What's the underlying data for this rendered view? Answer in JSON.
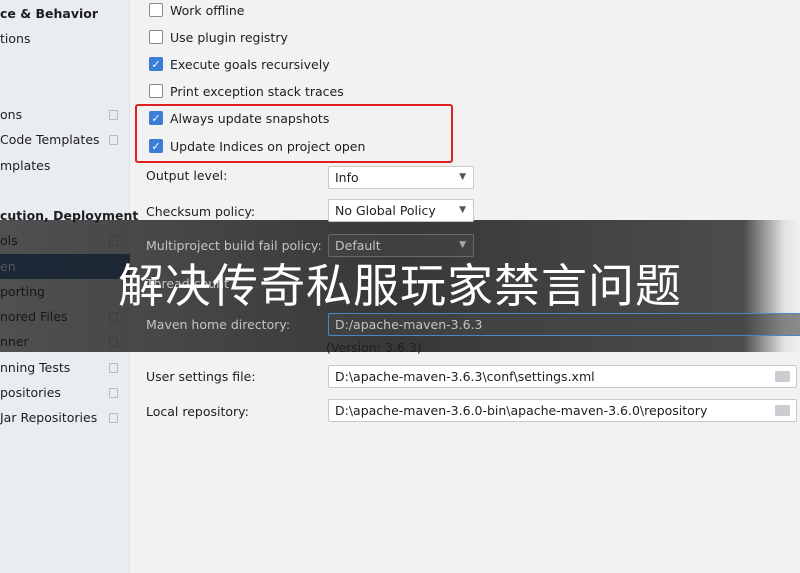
{
  "sidebar": {
    "items": [
      {
        "label": "ce & Behavior",
        "bold": true
      },
      {
        "label": "tions"
      },
      {
        "label": "ons",
        "copy": true
      },
      {
        "label": " Code Templates",
        "copy": true
      },
      {
        "label": "mplates"
      },
      {
        "label": "cution, Deployment",
        "bold": true
      },
      {
        "label": "ols",
        "copy": true
      },
      {
        "label": "en",
        "selected": true
      },
      {
        "label": "porting"
      },
      {
        "label": "nored Files",
        "copy": true
      },
      {
        "label": "nner",
        "copy": true
      },
      {
        "label": "nning Tests",
        "copy": true
      },
      {
        "label": "positories",
        "copy": true
      },
      {
        "label": " Jar Repositories",
        "copy": true
      }
    ]
  },
  "checkboxes": [
    {
      "label": "Work offline",
      "checked": false
    },
    {
      "label": "Use plugin registry",
      "checked": false
    },
    {
      "label": "Execute goals recursively",
      "checked": true
    },
    {
      "label": "Print exception stack traces",
      "checked": false
    },
    {
      "label": "Always update snapshots",
      "checked": true
    },
    {
      "label": "Update Indices on project open",
      "checked": true
    }
  ],
  "fields": {
    "output_level": {
      "label": "Output level:",
      "value": "Info"
    },
    "checksum_policy": {
      "label": "Checksum policy:",
      "value": "No Global Policy"
    },
    "fail_policy": {
      "label": "Multiproject build fail policy:",
      "value": "Default"
    },
    "thread_count": {
      "label": "Thread count"
    },
    "maven_home": {
      "label": "Maven home directory:",
      "value": "D:/apache-maven-3.6.3"
    },
    "version": "(Version: 3.6.3)",
    "user_settings": {
      "label": "User settings file:",
      "value": "D:\\apache-maven-3.6.3\\conf\\settings.xml"
    },
    "local_repo": {
      "label": "Local repository:",
      "value": "D:\\apache-maven-3.6.0-bin\\apache-maven-3.6.0\\repository"
    }
  },
  "overlay_title": "解决传奇私服玩家禁言问题",
  "colors": {
    "highlight": "#e02020",
    "accent": "#3b7ed6",
    "selected": "#2b5a8f"
  }
}
